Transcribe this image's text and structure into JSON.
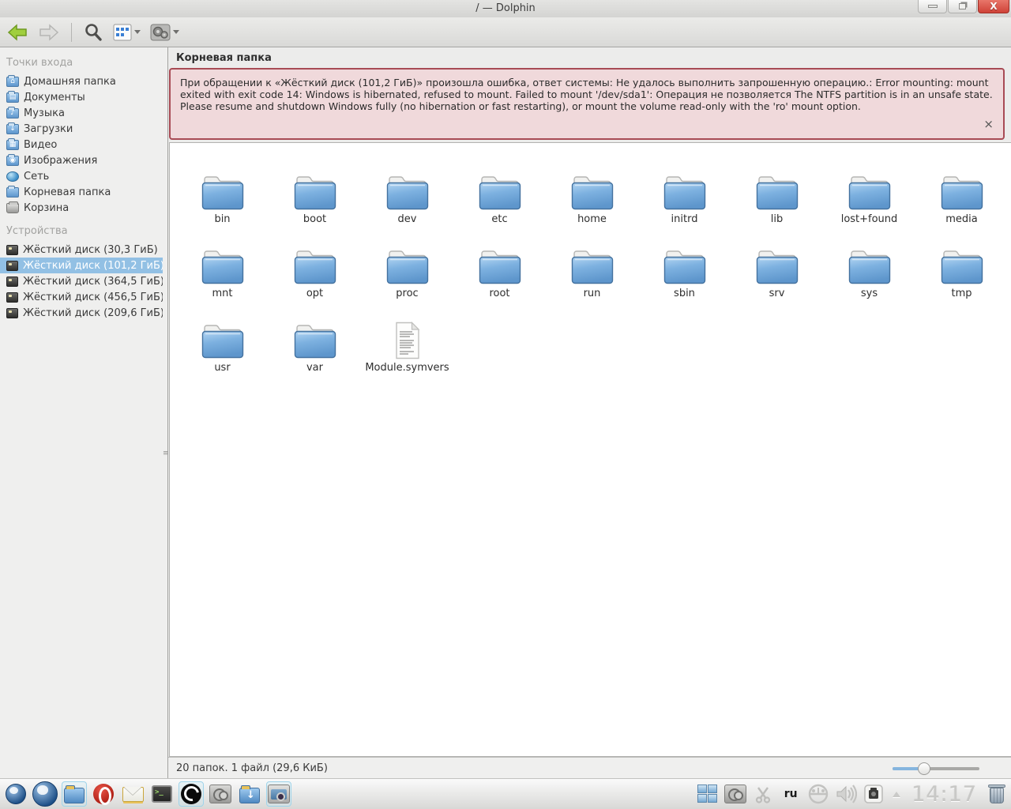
{
  "window": {
    "title": "/ — Dolphin",
    "controls": {
      "minimize": "–",
      "maximize": "□",
      "close": "X"
    }
  },
  "toolbar": {
    "back_icon": "back-arrow",
    "forward_icon": "forward-arrow",
    "search_icon": "magnifier",
    "view_mode_icon": "icons-view-grid",
    "tools_icon": "gears"
  },
  "sidebar": {
    "places_header": "Точки входа",
    "places": [
      {
        "label": "Домашняя папка",
        "icon": "home-folder",
        "glyph": "⌂"
      },
      {
        "label": "Документы",
        "icon": "documents-folder",
        "glyph": "▤"
      },
      {
        "label": "Музыка",
        "icon": "music-folder",
        "glyph": "♪"
      },
      {
        "label": "Загрузки",
        "icon": "downloads-folder",
        "glyph": "↓"
      },
      {
        "label": "Видео",
        "icon": "video-folder",
        "glyph": "▦"
      },
      {
        "label": "Изображения",
        "icon": "pictures-folder",
        "glyph": "◉"
      },
      {
        "label": "Сеть",
        "icon": "network",
        "glyph": ""
      },
      {
        "label": "Корневая папка",
        "icon": "root-folder",
        "glyph": ""
      },
      {
        "label": "Корзина",
        "icon": "trash",
        "glyph": ""
      }
    ],
    "devices_header": "Устройства",
    "devices": [
      {
        "label": "Жёсткий диск (30,3 ГиБ)",
        "selected": false
      },
      {
        "label": "Жёсткий диск (101,2 ГиБ)",
        "selected": true
      },
      {
        "label": "Жёсткий диск (364,5 ГиБ)",
        "selected": false
      },
      {
        "label": "Жёсткий диск (456,5 ГиБ)",
        "selected": false
      },
      {
        "label": "Жёсткий диск (209,6 ГиБ)",
        "selected": false
      }
    ]
  },
  "content": {
    "location_header": "Корневая папка",
    "error": {
      "text": "При обращении к «Жёсткий диск (101,2 ГиБ)» произошла ошибка, ответ системы: Не удалось выполнить запрошенную операцию.: Error mounting: mount exited with exit code 14: Windows is hibernated, refused to mount. Failed to mount '/dev/sda1': Операция не позволяется The NTFS partition is in an unsafe state. Please resume and shutdown Windows fully (no hibernation or fast restarting), or mount the volume read-only with the 'ro' mount option.",
      "close_glyph": "×"
    },
    "items": [
      {
        "name": "bin",
        "type": "folder"
      },
      {
        "name": "boot",
        "type": "folder"
      },
      {
        "name": "dev",
        "type": "folder"
      },
      {
        "name": "etc",
        "type": "folder"
      },
      {
        "name": "home",
        "type": "folder"
      },
      {
        "name": "initrd",
        "type": "folder"
      },
      {
        "name": "lib",
        "type": "folder"
      },
      {
        "name": "lost+found",
        "type": "folder"
      },
      {
        "name": "media",
        "type": "folder"
      },
      {
        "name": "mnt",
        "type": "folder"
      },
      {
        "name": "opt",
        "type": "folder"
      },
      {
        "name": "proc",
        "type": "folder"
      },
      {
        "name": "root",
        "type": "folder"
      },
      {
        "name": "run",
        "type": "folder"
      },
      {
        "name": "sbin",
        "type": "folder"
      },
      {
        "name": "srv",
        "type": "folder"
      },
      {
        "name": "sys",
        "type": "folder"
      },
      {
        "name": "tmp",
        "type": "folder"
      },
      {
        "name": "usr",
        "type": "folder"
      },
      {
        "name": "var",
        "type": "folder"
      },
      {
        "name": "Module.symvers",
        "type": "file"
      }
    ],
    "statusbar": {
      "summary": "20 папок. 1 файл (29,6 КиБ)"
    }
  },
  "taskbar": {
    "apps": [
      {
        "name": "menu-orb-small",
        "highlighted": false
      },
      {
        "name": "menu-orb-large",
        "highlighted": false
      },
      {
        "name": "file-manager",
        "highlighted": true
      },
      {
        "name": "opera",
        "highlighted": false
      },
      {
        "name": "mail",
        "highlighted": false
      },
      {
        "name": "terminal",
        "highlighted": false
      },
      {
        "name": "browser-dark",
        "highlighted": true
      },
      {
        "name": "control-center",
        "highlighted": false
      },
      {
        "name": "downloads",
        "highlighted": false
      },
      {
        "name": "archive-manager",
        "highlighted": true
      }
    ],
    "terminal_glyph": ">_",
    "tray": {
      "keyboard_layout": "ru",
      "clock": "14:17"
    }
  },
  "colors": {
    "accent_selection": "#92c0e4",
    "error_bg": "#f0d9db",
    "error_border": "#a84b55",
    "folder_blue_top": "#b1d4f2",
    "folder_blue_bottom": "#5e96cc",
    "close_button_red": "#cf4237"
  }
}
